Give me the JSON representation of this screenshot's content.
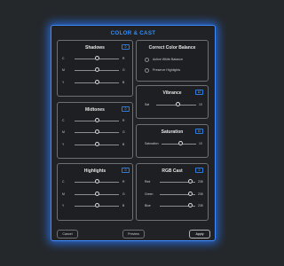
{
  "dialog": {
    "title": "COLOR & CAST"
  },
  "shadows": {
    "title": "Shadows",
    "value": "0",
    "sliders": [
      {
        "left": "C",
        "right": "R",
        "level": 0.5
      },
      {
        "left": "M",
        "right": "G",
        "level": 0.5
      },
      {
        "left": "Y",
        "right": "B",
        "level": 0.5
      }
    ]
  },
  "midtones": {
    "title": "Midtones",
    "value": "0",
    "sliders": [
      {
        "left": "C",
        "right": "R",
        "level": 0.5
      },
      {
        "left": "M",
        "right": "G",
        "level": 0.5
      },
      {
        "left": "Y",
        "right": "B",
        "level": 0.5
      }
    ]
  },
  "highlights": {
    "title": "Highlights",
    "value": "0",
    "sliders": [
      {
        "left": "C",
        "right": "R",
        "level": 0.5
      },
      {
        "left": "M",
        "right": "G",
        "level": 0.5
      },
      {
        "left": "Y",
        "right": "B",
        "level": 0.5
      }
    ]
  },
  "correct_balance": {
    "title": "Correct Color Balance",
    "options": [
      {
        "label": "Active White Balance"
      },
      {
        "label": "Preserve Highlights"
      }
    ]
  },
  "vibrance": {
    "title": "Vibrance",
    "value": "10",
    "slider": {
      "left": "Sat",
      "right": "10",
      "level": 0.55
    }
  },
  "saturation": {
    "title": "Saturation",
    "value": "10",
    "slider": {
      "left": "Saturation",
      "right": "10",
      "level": 0.55
    }
  },
  "rgb_cast": {
    "title": "RGB Cast",
    "value": "0",
    "sliders": [
      {
        "left": "Red",
        "right": "235",
        "level": 0.85
      },
      {
        "left": "Green",
        "right": "235",
        "level": 0.85
      },
      {
        "left": "Blue",
        "right": "235",
        "level": 0.85
      }
    ]
  },
  "buttons": {
    "cancel": "Cancel",
    "preview": "Preview",
    "apply": "Apply"
  },
  "colors": {
    "accent": "#2e8fff",
    "glow": "#2878ff",
    "panel_border": "#6d7075"
  }
}
